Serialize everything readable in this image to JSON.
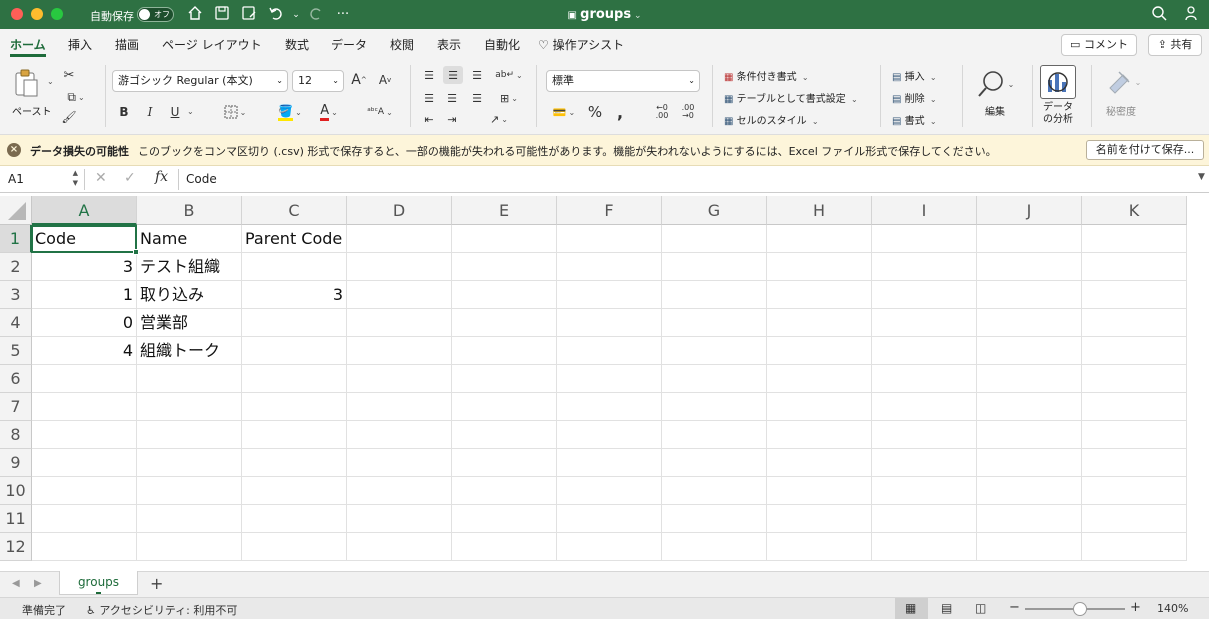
{
  "titlebar": {
    "autosave_label": "自動保存",
    "autosave_toggle": "オフ",
    "doc_title": "groups"
  },
  "tabs": [
    "ホーム",
    "挿入",
    "描画",
    "ページ レイアウト",
    "数式",
    "データ",
    "校閲",
    "表示",
    "自動化",
    "操作アシスト"
  ],
  "active_tab": "ホーム",
  "tab_actions": {
    "comment": "コメント",
    "share": "共有"
  },
  "ribbon": {
    "paste": "ペースト",
    "font_name": "游ゴシック Regular (本文)",
    "font_size": "12",
    "bold": "B",
    "italic": "I",
    "underline": "U",
    "number_format": "標準",
    "cond_format": "条件付き書式",
    "table_format": "テーブルとして書式設定",
    "cell_style": "セルのスタイル",
    "insert": "挿入",
    "delete": "削除",
    "format": "書式",
    "edit": "編集",
    "analyze": "データ\nの分析",
    "analyze_l1": "データ",
    "analyze_l2": "の分析",
    "sensitivity": "秘密度"
  },
  "message": {
    "title": "データ損失の可能性",
    "text": "このブックをコンマ区切り (.csv) 形式で保存すると、一部の機能が失われる可能性があります。機能が失われないようにするには、Excel ファイル形式で保存してください。",
    "button": "名前を付けて保存..."
  },
  "formula_bar": {
    "name_box": "A1",
    "fx": "fx",
    "content": "Code"
  },
  "columns": [
    "A",
    "B",
    "C",
    "D",
    "E",
    "F",
    "G",
    "H",
    "I",
    "J",
    "K"
  ],
  "rows": [
    "1",
    "2",
    "3",
    "4",
    "5",
    "6",
    "7",
    "8",
    "9",
    "10",
    "11",
    "12"
  ],
  "cells": {
    "A1": "Code",
    "B1": "Name",
    "C1": "Parent Code",
    "A2": "3",
    "B2": "テスト組織",
    "A3": "1",
    "B3": "取り込み",
    "C3": "3",
    "A4": "0",
    "B4": "営業部",
    "A5": "4",
    "B5": "組織トーク"
  },
  "sheet_tabs": [
    "groups"
  ],
  "status": {
    "ready": "準備完了",
    "accessibility": "アクセシビリティ: 利用不可",
    "zoom": "140%"
  },
  "colors": {
    "accent": "#2e7143",
    "selection": "#217346"
  }
}
